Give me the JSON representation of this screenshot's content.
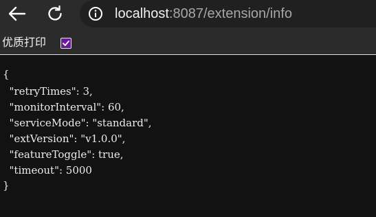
{
  "browser": {
    "url_host": "localhost",
    "url_rest": ":8087/extension/info",
    "icons": [
      "back-arrow-icon",
      "reload-icon",
      "info-icon"
    ]
  },
  "pretty_print": {
    "label": "优质打印",
    "checked": true,
    "accent_color": "#6a1b9a"
  },
  "json": {
    "open_brace": "{",
    "lines": [
      "  \"retryTimes\": 3,",
      "  \"monitorInterval\": 60,",
      "  \"serviceMode\": \"standard\",",
      "  \"extVersion\": \"v1.0.0\",",
      "  \"featureToggle\": true,",
      "  \"timeout\": 5000"
    ],
    "close_brace": "}"
  }
}
